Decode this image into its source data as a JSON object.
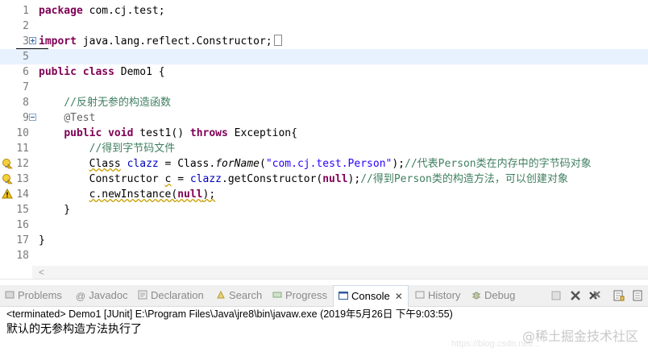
{
  "editor": {
    "lines": [
      {
        "num": "1",
        "code": "package com.cj.test;"
      },
      {
        "num": "2",
        "code": ""
      },
      {
        "num": "3",
        "code": "import java.lang.reflect.Constructor;"
      },
      {
        "num": "5",
        "code": ""
      },
      {
        "num": "6",
        "code": "public class Demo1 {"
      },
      {
        "num": "7",
        "code": ""
      },
      {
        "num": "8",
        "code": "    //反射无参的构造函数"
      },
      {
        "num": "9",
        "code": "    @Test"
      },
      {
        "num": "10",
        "code": "    public void test1() throws Exception{"
      },
      {
        "num": "11",
        "code": "        //得到字节码文件"
      },
      {
        "num": "12",
        "code": "        Class clazz = Class.forName(\"com.cj.test.Person\");//代表Person类在内存中的字节码对象"
      },
      {
        "num": "13",
        "code": "        Constructor c = clazz.getConstructor(null);//得到Person类的构造方法，可以创建对象"
      },
      {
        "num": "14",
        "code": "        c.newInstance(null);"
      },
      {
        "num": "15",
        "code": "    }"
      },
      {
        "num": "16",
        "code": ""
      },
      {
        "num": "17",
        "code": "}"
      },
      {
        "num": "18",
        "code": ""
      }
    ]
  },
  "views": {
    "tabs": [
      {
        "label": "Problems",
        "icon": "problems-icon"
      },
      {
        "label": "Javadoc",
        "icon": "javadoc-icon"
      },
      {
        "label": "Declaration",
        "icon": "declaration-icon"
      },
      {
        "label": "Search",
        "icon": "search-icon"
      },
      {
        "label": "Progress",
        "icon": "progress-icon"
      },
      {
        "label": "Console",
        "icon": "console-icon",
        "active": true
      },
      {
        "label": "History",
        "icon": "history-icon"
      },
      {
        "label": "Debug",
        "icon": "debug-icon"
      }
    ],
    "close_glyph": "✕"
  },
  "console": {
    "status": "<terminated> Demo1 [JUnit] E:\\Program Files\\Java\\jre8\\bin\\javaw.exe (2019年5月26日 下午9:03:55)",
    "output": "默认的无参构造方法执行了"
  },
  "watermark": {
    "text": "@稀土掘金技术社区",
    "faint": "https://blog.csdn.net/..."
  },
  "colors": {
    "keyword": "#7f0055",
    "comment": "#3f7f5f",
    "string": "#2a00ff",
    "current_line": "#e8f2fe"
  }
}
